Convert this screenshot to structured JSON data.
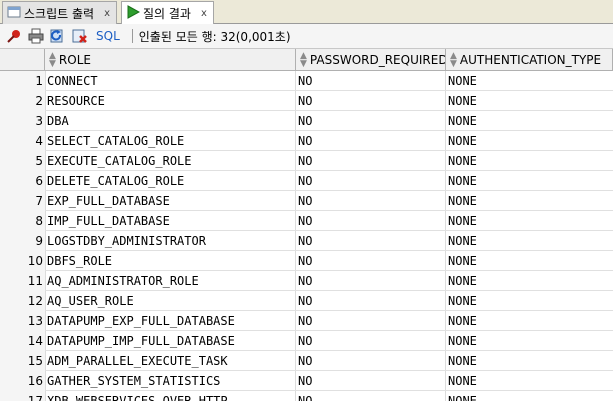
{
  "tabs": [
    {
      "label": "스크립트 출력",
      "close": "x",
      "active": false
    },
    {
      "label": "질의 결과",
      "close": "x",
      "active": true
    }
  ],
  "toolbar": {
    "icons": [
      "pin-icon",
      "print-icon",
      "refresh-icon",
      "clear-icon"
    ],
    "sql_label": "SQL",
    "status": "인출된 모든 행: 32(0,001초)"
  },
  "grid": {
    "columns": [
      "ROLE",
      "PASSWORD_REQUIRED",
      "AUTHENTICATION_TYPE"
    ],
    "rows": [
      {
        "num": "1",
        "role": "CONNECT",
        "pwd": "NO",
        "auth": "NONE"
      },
      {
        "num": "2",
        "role": "RESOURCE",
        "pwd": "NO",
        "auth": "NONE"
      },
      {
        "num": "3",
        "role": "DBA",
        "pwd": "NO",
        "auth": "NONE"
      },
      {
        "num": "4",
        "role": "SELECT_CATALOG_ROLE",
        "pwd": "NO",
        "auth": "NONE"
      },
      {
        "num": "5",
        "role": "EXECUTE_CATALOG_ROLE",
        "pwd": "NO",
        "auth": "NONE"
      },
      {
        "num": "6",
        "role": "DELETE_CATALOG_ROLE",
        "pwd": "NO",
        "auth": "NONE"
      },
      {
        "num": "7",
        "role": "EXP_FULL_DATABASE",
        "pwd": "NO",
        "auth": "NONE"
      },
      {
        "num": "8",
        "role": "IMP_FULL_DATABASE",
        "pwd": "NO",
        "auth": "NONE"
      },
      {
        "num": "9",
        "role": "LOGSTDBY_ADMINISTRATOR",
        "pwd": "NO",
        "auth": "NONE"
      },
      {
        "num": "10",
        "role": "DBFS_ROLE",
        "pwd": "NO",
        "auth": "NONE"
      },
      {
        "num": "11",
        "role": "AQ_ADMINISTRATOR_ROLE",
        "pwd": "NO",
        "auth": "NONE"
      },
      {
        "num": "12",
        "role": "AQ_USER_ROLE",
        "pwd": "NO",
        "auth": "NONE"
      },
      {
        "num": "13",
        "role": "DATAPUMP_EXP_FULL_DATABASE",
        "pwd": "NO",
        "auth": "NONE"
      },
      {
        "num": "14",
        "role": "DATAPUMP_IMP_FULL_DATABASE",
        "pwd": "NO",
        "auth": "NONE"
      },
      {
        "num": "15",
        "role": "ADM_PARALLEL_EXECUTE_TASK",
        "pwd": "NO",
        "auth": "NONE"
      },
      {
        "num": "16",
        "role": "GATHER_SYSTEM_STATISTICS",
        "pwd": "NO",
        "auth": "NONE"
      },
      {
        "num": "17",
        "role": "XDB_WEBSERVICES_OVER_HTTP",
        "pwd": "NO",
        "auth": "NONE"
      }
    ]
  },
  "colors": {
    "accent": "#1c5ec4",
    "play": "#2e9e2e",
    "pin": "#d0241b"
  }
}
